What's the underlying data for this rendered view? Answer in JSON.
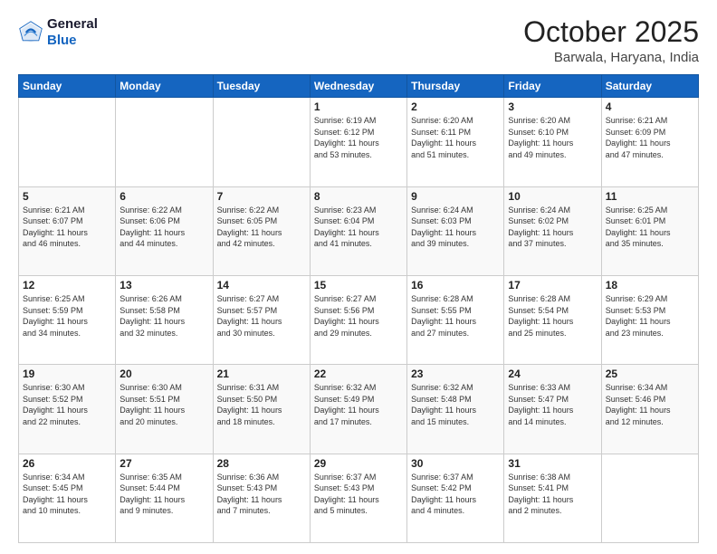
{
  "header": {
    "logo_line1": "General",
    "logo_line2": "Blue",
    "month": "October 2025",
    "location": "Barwala, Haryana, India"
  },
  "weekdays": [
    "Sunday",
    "Monday",
    "Tuesday",
    "Wednesday",
    "Thursday",
    "Friday",
    "Saturday"
  ],
  "weeks": [
    [
      {
        "day": "",
        "info": ""
      },
      {
        "day": "",
        "info": ""
      },
      {
        "day": "",
        "info": ""
      },
      {
        "day": "1",
        "info": "Sunrise: 6:19 AM\nSunset: 6:12 PM\nDaylight: 11 hours\nand 53 minutes."
      },
      {
        "day": "2",
        "info": "Sunrise: 6:20 AM\nSunset: 6:11 PM\nDaylight: 11 hours\nand 51 minutes."
      },
      {
        "day": "3",
        "info": "Sunrise: 6:20 AM\nSunset: 6:10 PM\nDaylight: 11 hours\nand 49 minutes."
      },
      {
        "day": "4",
        "info": "Sunrise: 6:21 AM\nSunset: 6:09 PM\nDaylight: 11 hours\nand 47 minutes."
      }
    ],
    [
      {
        "day": "5",
        "info": "Sunrise: 6:21 AM\nSunset: 6:07 PM\nDaylight: 11 hours\nand 46 minutes."
      },
      {
        "day": "6",
        "info": "Sunrise: 6:22 AM\nSunset: 6:06 PM\nDaylight: 11 hours\nand 44 minutes."
      },
      {
        "day": "7",
        "info": "Sunrise: 6:22 AM\nSunset: 6:05 PM\nDaylight: 11 hours\nand 42 minutes."
      },
      {
        "day": "8",
        "info": "Sunrise: 6:23 AM\nSunset: 6:04 PM\nDaylight: 11 hours\nand 41 minutes."
      },
      {
        "day": "9",
        "info": "Sunrise: 6:24 AM\nSunset: 6:03 PM\nDaylight: 11 hours\nand 39 minutes."
      },
      {
        "day": "10",
        "info": "Sunrise: 6:24 AM\nSunset: 6:02 PM\nDaylight: 11 hours\nand 37 minutes."
      },
      {
        "day": "11",
        "info": "Sunrise: 6:25 AM\nSunset: 6:01 PM\nDaylight: 11 hours\nand 35 minutes."
      }
    ],
    [
      {
        "day": "12",
        "info": "Sunrise: 6:25 AM\nSunset: 5:59 PM\nDaylight: 11 hours\nand 34 minutes."
      },
      {
        "day": "13",
        "info": "Sunrise: 6:26 AM\nSunset: 5:58 PM\nDaylight: 11 hours\nand 32 minutes."
      },
      {
        "day": "14",
        "info": "Sunrise: 6:27 AM\nSunset: 5:57 PM\nDaylight: 11 hours\nand 30 minutes."
      },
      {
        "day": "15",
        "info": "Sunrise: 6:27 AM\nSunset: 5:56 PM\nDaylight: 11 hours\nand 29 minutes."
      },
      {
        "day": "16",
        "info": "Sunrise: 6:28 AM\nSunset: 5:55 PM\nDaylight: 11 hours\nand 27 minutes."
      },
      {
        "day": "17",
        "info": "Sunrise: 6:28 AM\nSunset: 5:54 PM\nDaylight: 11 hours\nand 25 minutes."
      },
      {
        "day": "18",
        "info": "Sunrise: 6:29 AM\nSunset: 5:53 PM\nDaylight: 11 hours\nand 23 minutes."
      }
    ],
    [
      {
        "day": "19",
        "info": "Sunrise: 6:30 AM\nSunset: 5:52 PM\nDaylight: 11 hours\nand 22 minutes."
      },
      {
        "day": "20",
        "info": "Sunrise: 6:30 AM\nSunset: 5:51 PM\nDaylight: 11 hours\nand 20 minutes."
      },
      {
        "day": "21",
        "info": "Sunrise: 6:31 AM\nSunset: 5:50 PM\nDaylight: 11 hours\nand 18 minutes."
      },
      {
        "day": "22",
        "info": "Sunrise: 6:32 AM\nSunset: 5:49 PM\nDaylight: 11 hours\nand 17 minutes."
      },
      {
        "day": "23",
        "info": "Sunrise: 6:32 AM\nSunset: 5:48 PM\nDaylight: 11 hours\nand 15 minutes."
      },
      {
        "day": "24",
        "info": "Sunrise: 6:33 AM\nSunset: 5:47 PM\nDaylight: 11 hours\nand 14 minutes."
      },
      {
        "day": "25",
        "info": "Sunrise: 6:34 AM\nSunset: 5:46 PM\nDaylight: 11 hours\nand 12 minutes."
      }
    ],
    [
      {
        "day": "26",
        "info": "Sunrise: 6:34 AM\nSunset: 5:45 PM\nDaylight: 11 hours\nand 10 minutes."
      },
      {
        "day": "27",
        "info": "Sunrise: 6:35 AM\nSunset: 5:44 PM\nDaylight: 11 hours\nand 9 minutes."
      },
      {
        "day": "28",
        "info": "Sunrise: 6:36 AM\nSunset: 5:43 PM\nDaylight: 11 hours\nand 7 minutes."
      },
      {
        "day": "29",
        "info": "Sunrise: 6:37 AM\nSunset: 5:43 PM\nDaylight: 11 hours\nand 5 minutes."
      },
      {
        "day": "30",
        "info": "Sunrise: 6:37 AM\nSunset: 5:42 PM\nDaylight: 11 hours\nand 4 minutes."
      },
      {
        "day": "31",
        "info": "Sunrise: 6:38 AM\nSunset: 5:41 PM\nDaylight: 11 hours\nand 2 minutes."
      },
      {
        "day": "",
        "info": ""
      }
    ]
  ]
}
